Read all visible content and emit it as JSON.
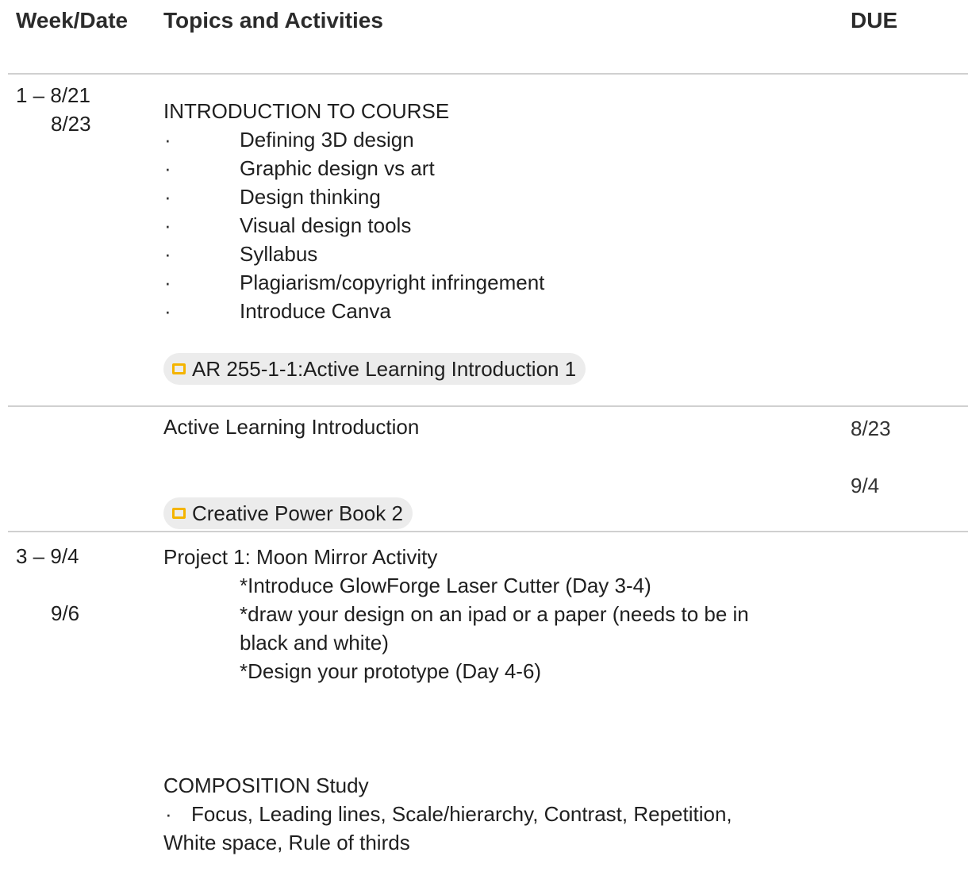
{
  "header": {
    "week_date": "Week/Date",
    "topics": "Topics and Activities",
    "due": "DUE"
  },
  "row1": {
    "week": "1 – 8/21",
    "date2": "8/23",
    "title": "INTRODUCTION TO COURSE",
    "bullet_symbol": "·",
    "items": [
      "Defining 3D design",
      "Graphic design vs art",
      "Design thinking",
      "Visual design tools",
      "Syllabus",
      "Plagiarism/copyright infringement",
      "Introduce Canva"
    ],
    "chip": {
      "label": "AR 255-1-1:Active Learning Introduction 1",
      "icon": "slides-icon",
      "icon_color": "#f4b400"
    }
  },
  "row2": {
    "title": "Active Learning Introduction",
    "due1": "8/23",
    "due2": "9/4",
    "chip": {
      "label": "Creative Power Book 2",
      "icon": "slides-icon",
      "icon_color": "#f4b400"
    }
  },
  "row3": {
    "week": "3 – 9/4",
    "date2": "9/6",
    "title": "Project 1: Moon Mirror Activity",
    "lines": [
      "*Introduce GlowForge Laser Cutter (Day 3-4)",
      "*draw your design on an ipad or a paper (needs to be in",
      "black and white)",
      "*Design your prototype (Day 4-6)"
    ],
    "composition_title": "COMPOSITION Study",
    "composition_bullet": "·",
    "composition_line1": "Focus, Leading lines, Scale/hierarchy, Contrast, Repetition,",
    "composition_line2": "White space, Rule of thirds"
  }
}
